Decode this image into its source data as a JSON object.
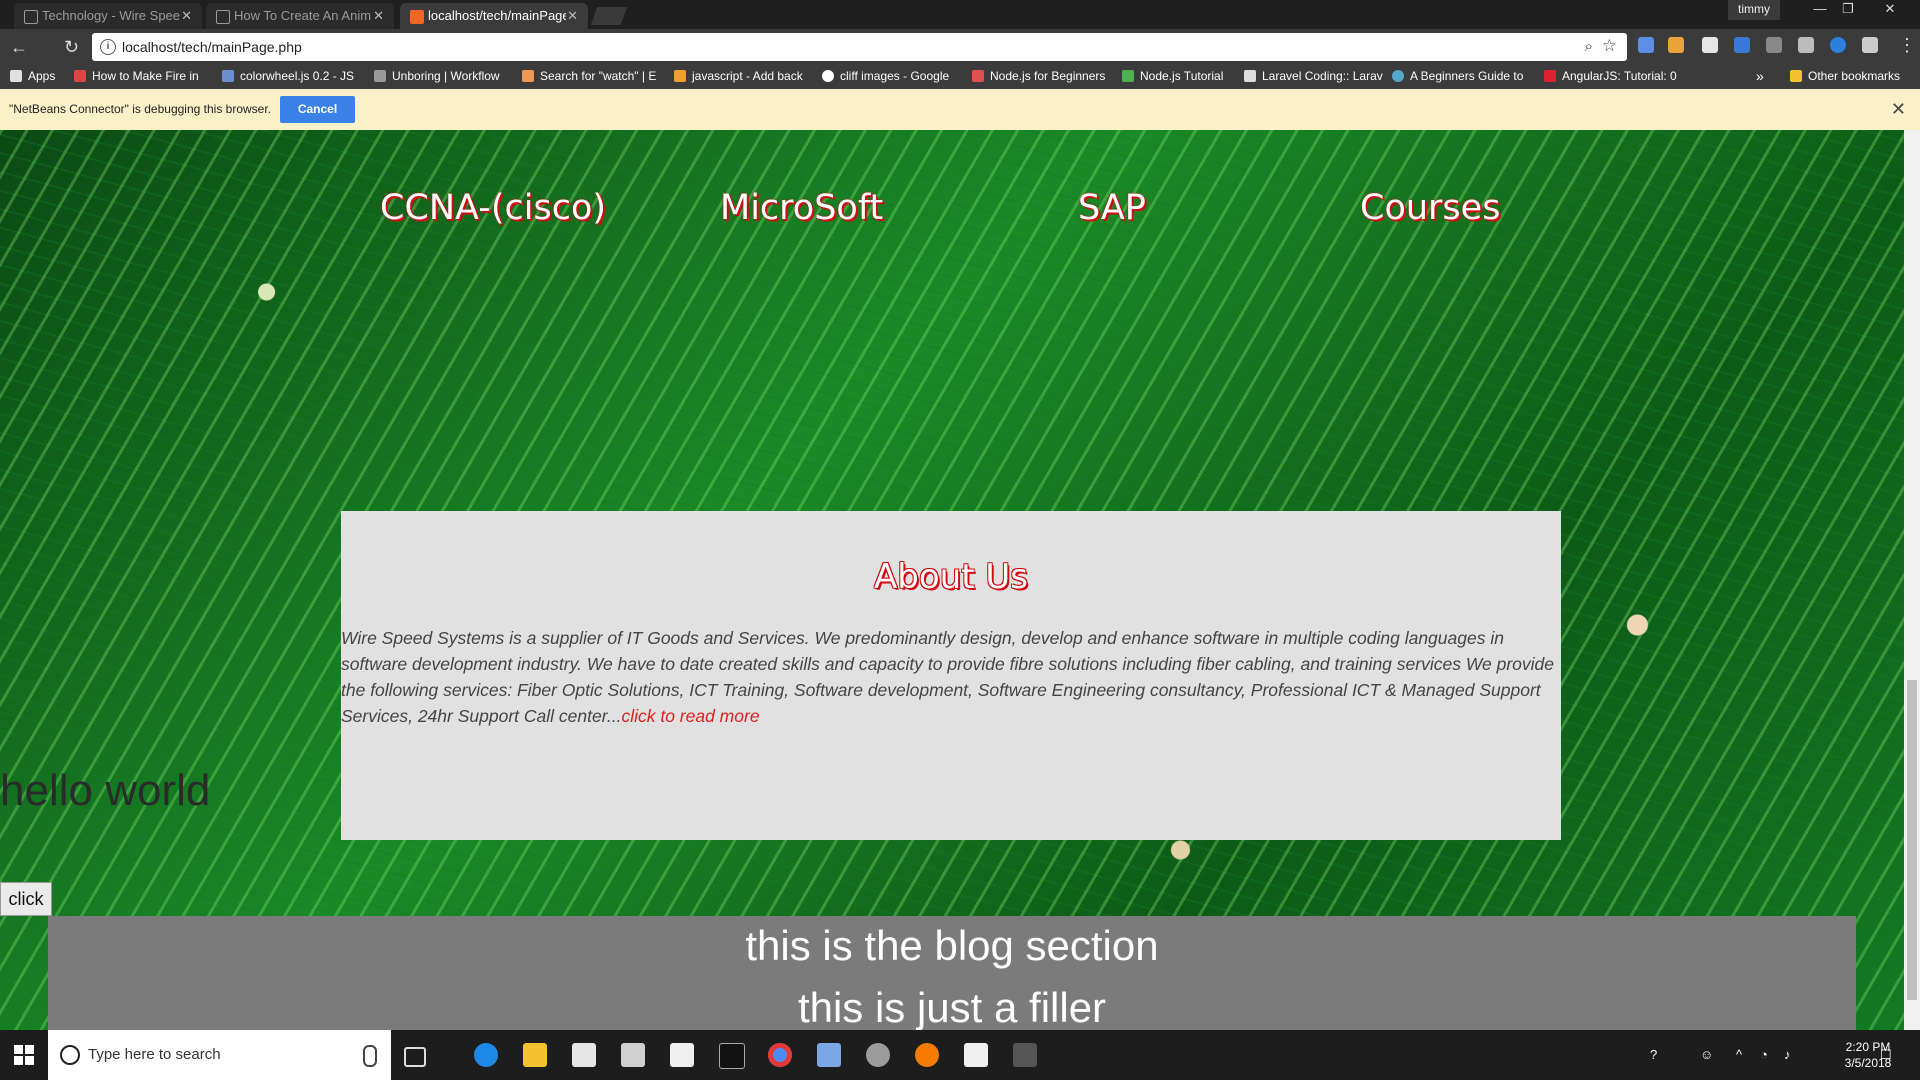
{
  "browser": {
    "tabs": [
      {
        "title": "Technology - Wire Spee",
        "active": false
      },
      {
        "title": "How To Create An Anim",
        "active": false
      },
      {
        "title": "localhost/tech/mainPage",
        "active": true
      }
    ],
    "user": "timmy",
    "url": "localhost/tech/mainPage.php",
    "bookmarks": [
      "Apps",
      "How to Make Fire in",
      "colorwheel.js 0.2 - JS",
      "Unboring | Workflow",
      "Search for \"watch\" | E",
      "javascript - Add back",
      "cliff images - Google",
      "Node.js for Beginners",
      "Node.js Tutorial",
      "Laravel Coding:: Larav",
      "A Beginners Guide to",
      "AngularJS: Tutorial: 0",
      "Other bookmarks"
    ],
    "chevron": "»",
    "infobar": {
      "message": "\"NetBeans Connector\" is debugging this browser.",
      "cancel_label": "Cancel",
      "close_glyph": "✕"
    }
  },
  "page": {
    "nav": [
      "CCNA-(cisco)",
      "MicroSoft",
      "SAP",
      "Courses"
    ],
    "about": {
      "heading": "About Us",
      "body": "Wire Speed Systems is a supplier of IT Goods and Services. We predominantly design, develop and enhance software in multiple coding languages in software development industry. We have to date created skills and capacity to provide fibre solutions including fiber cabling, and training services We provide the following services: Fiber Optic Solutions, ICT Training, Software development, Software Engineering consultancy, Professional ICT & Managed Support Services, 24hr Support Call center...",
      "more_link": "click to read more"
    },
    "hello_text": "hello world",
    "click_button": "click",
    "blog": {
      "line1": "this is the blog section",
      "line2": "this is just a filler"
    }
  },
  "taskbar": {
    "search_placeholder": "Type here to search",
    "time": "2:20 PM",
    "date": "3/5/2018"
  },
  "colors": {
    "accent_red": "#d10b12",
    "cancel_blue": "#3b82e8",
    "about_bg": "#e1e1e1",
    "blog_bg": "#7b7b7b"
  }
}
